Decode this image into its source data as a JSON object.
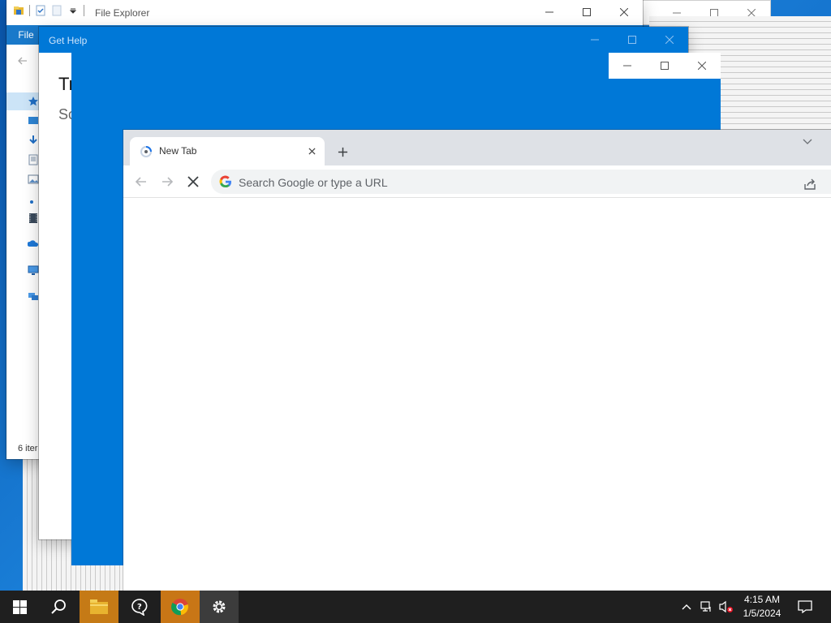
{
  "file_explorer": {
    "title": "File Explorer",
    "ribbon_file_label": "File",
    "status_text": "6 iter"
  },
  "get_help": {
    "title": "Get Help",
    "heading": "Tr",
    "subheading": "Sc"
  },
  "chrome": {
    "tab_title": "New Tab",
    "omnibox_placeholder": "Search Google or type a URL"
  },
  "taskbar": {
    "time": "4:15 AM",
    "date": "1/5/2024"
  },
  "colors": {
    "accent_blue": "#0078d7",
    "taskbar": "#1f1f1f",
    "taskbar_active": "#3c3c3c",
    "taskbar_orange": "#c57a16"
  }
}
